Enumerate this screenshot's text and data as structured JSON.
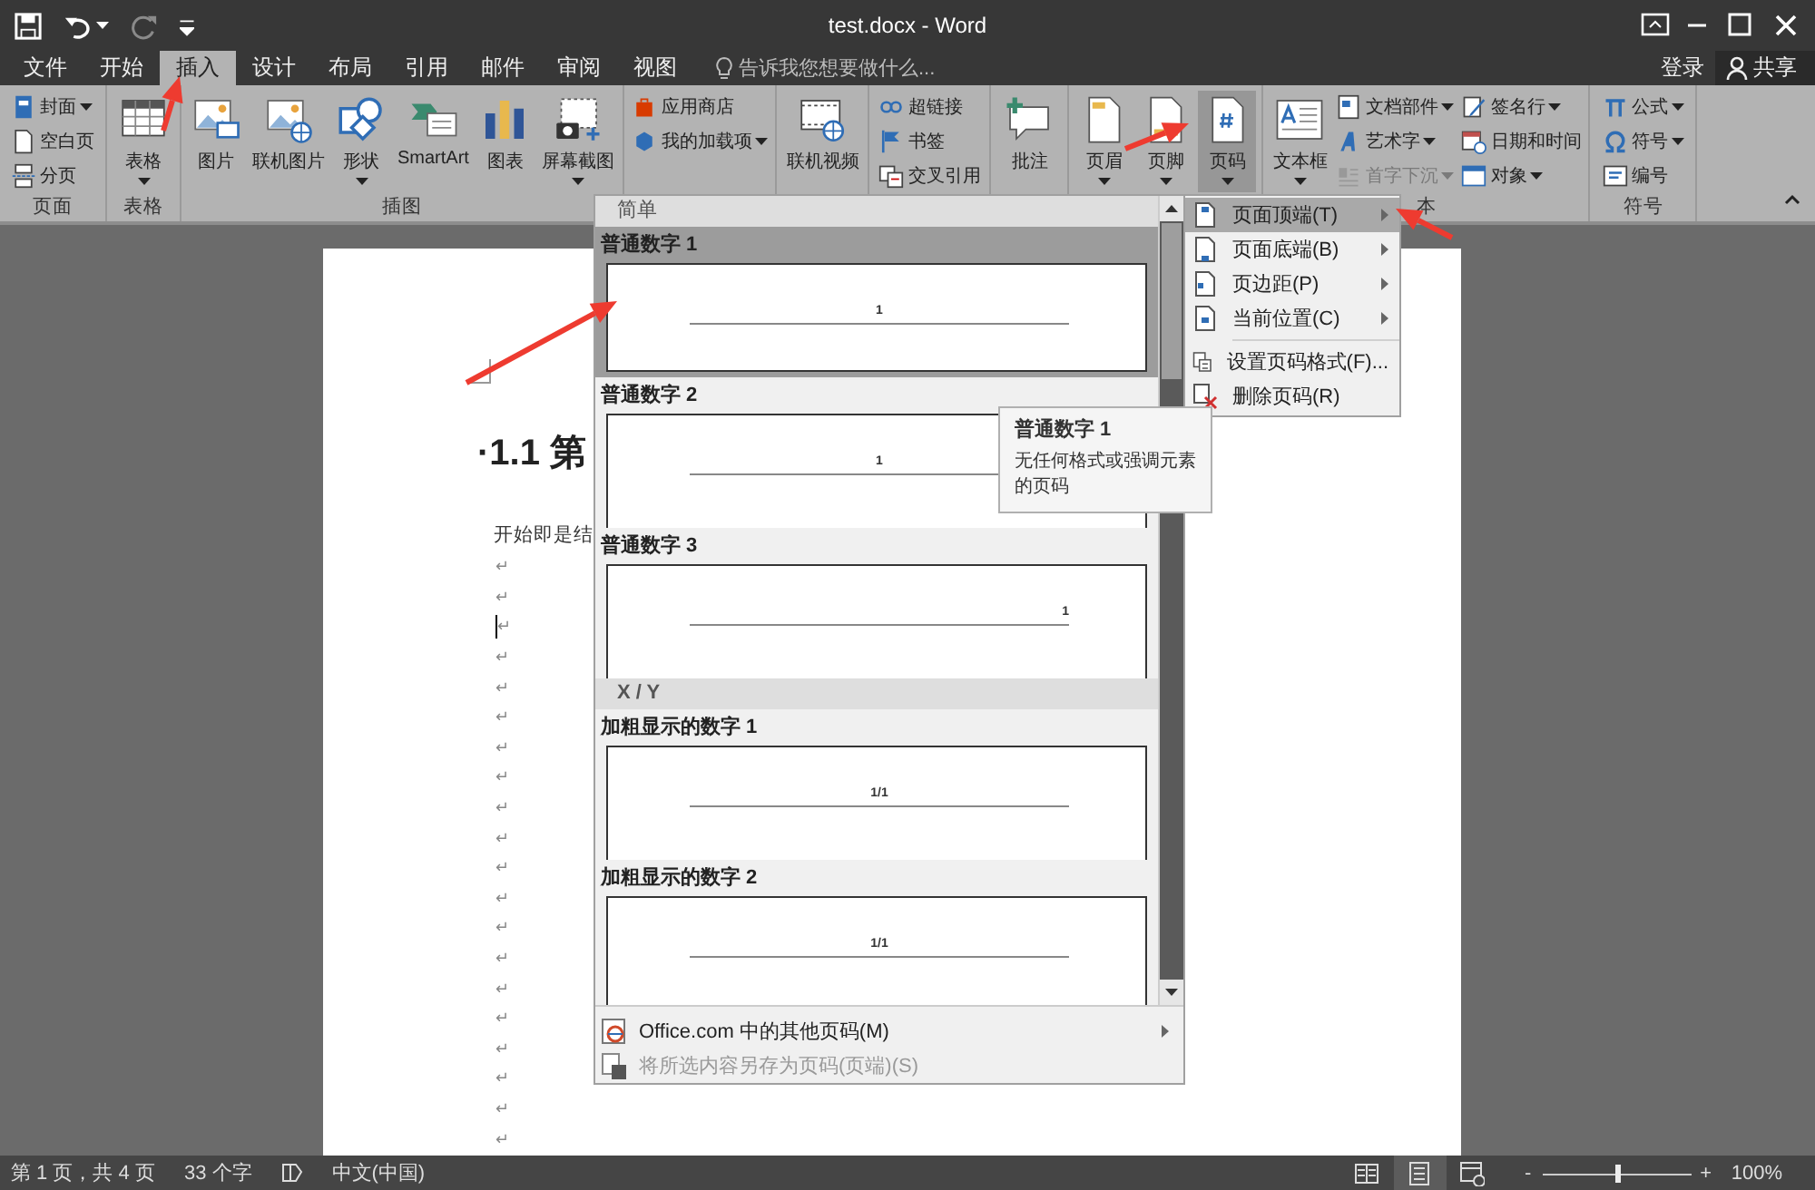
{
  "title_bar": {
    "title": "test.docx - Word",
    "quick_access": [
      {
        "kind": "save",
        "disabled": false
      },
      {
        "kind": "undo",
        "disabled": false
      },
      {
        "kind": "redo",
        "disabled": true
      },
      {
        "kind": "customize",
        "disabled": false
      }
    ]
  },
  "tabs": [
    {
      "label": "文件",
      "selected": false
    },
    {
      "label": "开始",
      "selected": false
    },
    {
      "label": "插入",
      "selected": true
    },
    {
      "label": "设计",
      "selected": false
    },
    {
      "label": "布局",
      "selected": false
    },
    {
      "label": "引用",
      "selected": false
    },
    {
      "label": "邮件",
      "selected": false
    },
    {
      "label": "审阅",
      "selected": false
    },
    {
      "label": "视图",
      "selected": false
    }
  ],
  "tell_me": {
    "placeholder": "告诉我您想要做什么..."
  },
  "account": {
    "sign_in": "登录",
    "share": "共享"
  },
  "ribbon": {
    "groups": [
      {
        "label": "页面",
        "items": [
          {
            "label": "封面",
            "kind": "small",
            "menu": true,
            "pressed": false,
            "disabled": false
          },
          {
            "label": "空白页",
            "kind": "small",
            "menu": false,
            "pressed": false,
            "disabled": false
          },
          {
            "label": "分页",
            "kind": "small",
            "menu": false,
            "pressed": false,
            "disabled": false
          }
        ]
      },
      {
        "label": "表格",
        "items": [
          {
            "label": "表格",
            "kind": "large",
            "menu": true,
            "pressed": false,
            "disabled": false
          }
        ]
      },
      {
        "label": "插图",
        "items": [
          {
            "label": "图片",
            "kind": "large",
            "menu": false,
            "pressed": false,
            "disabled": false
          },
          {
            "label": "联机图片",
            "kind": "large",
            "menu": false,
            "pressed": false,
            "disabled": false
          },
          {
            "label": "形状",
            "kind": "large",
            "menu": true,
            "pressed": false,
            "disabled": false
          },
          {
            "label": "SmartArt",
            "kind": "large",
            "menu": false,
            "pressed": false,
            "disabled": false
          },
          {
            "label": "图表",
            "kind": "large",
            "menu": false,
            "pressed": false,
            "disabled": false
          },
          {
            "label": "屏幕截图",
            "kind": "large",
            "menu": true,
            "pressed": false,
            "disabled": false
          }
        ]
      },
      {
        "items": [
          {
            "label": "应用商店",
            "kind": "small",
            "menu": false,
            "pressed": false,
            "disabled": false
          },
          {
            "label": "我的加载项",
            "kind": "small",
            "menu": true,
            "pressed": false,
            "disabled": false
          }
        ]
      },
      {
        "items": [
          {
            "label": "联机视频",
            "kind": "large",
            "menu": false,
            "pressed": false,
            "disabled": false
          }
        ]
      },
      {
        "items": [
          {
            "label": "超链接",
            "kind": "small",
            "menu": false,
            "pressed": false,
            "disabled": false
          },
          {
            "label": "书签",
            "kind": "small",
            "menu": false,
            "pressed": false,
            "disabled": false
          },
          {
            "label": "交叉引用",
            "kind": "small",
            "menu": false,
            "pressed": false,
            "disabled": false
          }
        ]
      },
      {
        "items": [
          {
            "label": "批注",
            "kind": "large",
            "menu": false,
            "pressed": false,
            "disabled": false
          }
        ]
      },
      {
        "items": [
          {
            "label": "页眉",
            "kind": "large",
            "menu": true,
            "pressed": false,
            "disabled": false
          },
          {
            "label": "页脚",
            "kind": "large",
            "menu": true,
            "pressed": false,
            "disabled": false
          },
          {
            "label": "页码",
            "kind": "large",
            "menu": true,
            "pressed": true,
            "disabled": false
          }
        ]
      },
      {
        "label": "本",
        "items": [
          {
            "label": "文本框",
            "kind": "large",
            "menu": true,
            "pressed": false,
            "disabled": false
          },
          {
            "label": "文档部件",
            "kind": "small",
            "menu": true,
            "pressed": false,
            "disabled": false
          },
          {
            "label": "艺术字",
            "kind": "small",
            "menu": true,
            "pressed": false,
            "disabled": false
          },
          {
            "label": "首字下沉",
            "kind": "small",
            "menu": true,
            "pressed": false,
            "disabled": true
          },
          {
            "label": "签名行",
            "kind": "small",
            "menu": true,
            "pressed": false,
            "disabled": false
          },
          {
            "label": "日期和时间",
            "kind": "small",
            "menu": false,
            "pressed": false,
            "disabled": false
          },
          {
            "label": "对象",
            "kind": "small",
            "menu": true,
            "pressed": false,
            "disabled": false
          }
        ]
      },
      {
        "label": "符号",
        "items": [
          {
            "label": "公式",
            "kind": "small",
            "menu": true,
            "pressed": false,
            "disabled": false
          },
          {
            "label": "符号",
            "kind": "small",
            "menu": true,
            "pressed": false,
            "disabled": false
          },
          {
            "label": "编号",
            "kind": "small",
            "menu": false,
            "pressed": false,
            "disabled": false
          }
        ]
      }
    ]
  },
  "document": {
    "heading": "·1.1 第",
    "paragraph": "开始即是结",
    "marks": [
      {
        "mark": "↵",
        "cursor": false
      },
      {
        "mark": "↵",
        "cursor": false
      },
      {
        "mark": "↵",
        "cursor": true
      },
      {
        "mark": "↵",
        "cursor": false
      },
      {
        "mark": "↵",
        "cursor": false
      },
      {
        "mark": "↵",
        "cursor": false
      },
      {
        "mark": "↵",
        "cursor": false
      },
      {
        "mark": "↵",
        "cursor": false
      },
      {
        "mark": "↵",
        "cursor": false
      },
      {
        "mark": "↵",
        "cursor": false
      },
      {
        "mark": "↵",
        "cursor": false
      },
      {
        "mark": "↵",
        "cursor": false
      },
      {
        "mark": "↵",
        "cursor": false
      },
      {
        "mark": "↵",
        "cursor": false
      },
      {
        "mark": "↵",
        "cursor": false
      },
      {
        "mark": "↵",
        "cursor": false
      },
      {
        "mark": "↵",
        "cursor": false
      },
      {
        "mark": "↵",
        "cursor": false
      },
      {
        "mark": "↵",
        "cursor": false
      },
      {
        "mark": "↵",
        "cursor": false
      }
    ]
  },
  "page_number_gallery": {
    "sections": [
      {
        "heading": "简单",
        "items": [
          {
            "label": "普通数字 1",
            "number": "1",
            "right_aligned": false,
            "selected": true
          },
          {
            "label": "普通数字 2",
            "number": "1",
            "right_aligned": false,
            "selected": false
          },
          {
            "label": "普通数字 3",
            "number": "1",
            "right_aligned": true,
            "selected": false
          }
        ]
      },
      {
        "heading": "X / Y",
        "items": [
          {
            "label": "加粗显示的数字 1",
            "number": "1/1",
            "right_aligned": false,
            "selected": false
          },
          {
            "label": "加粗显示的数字 2",
            "number": "1/1",
            "right_aligned": false,
            "selected": false
          }
        ]
      }
    ],
    "footer": [
      {
        "label": "Office.com 中的其他页码(M)",
        "submenu": true,
        "disabled": false
      },
      {
        "label": "将所选内容另存为页码(页端)(S)",
        "submenu": false,
        "disabled": true
      }
    ]
  },
  "page_number_menu": [
    {
      "label": "页面顶端(T)",
      "kind": "position",
      "selected": true
    },
    {
      "label": "页面底端(B)",
      "kind": "position",
      "selected": false
    },
    {
      "label": "页边距(P)",
      "kind": "position",
      "selected": false
    },
    {
      "label": "当前位置(C)",
      "kind": "position",
      "selected": false
    },
    {
      "label": "设置页码格式(F)...",
      "kind": "command",
      "selected": false
    },
    {
      "label": "删除页码(R)",
      "kind": "command",
      "selected": false
    }
  ],
  "tooltip": {
    "title": "普通数字 1",
    "text": "无任何格式或强调元素的页码"
  },
  "status_bar": {
    "page": "第 1 页，共 4 页",
    "words": "33 个字",
    "language": "中文(中国)",
    "views": [
      {
        "kind": "read",
        "selected": false
      },
      {
        "kind": "print",
        "selected": true
      },
      {
        "kind": "web",
        "selected": false
      }
    ],
    "zoom": {
      "minus": "-",
      "plus": "+",
      "level": 0.5,
      "reading": "100%"
    }
  }
}
